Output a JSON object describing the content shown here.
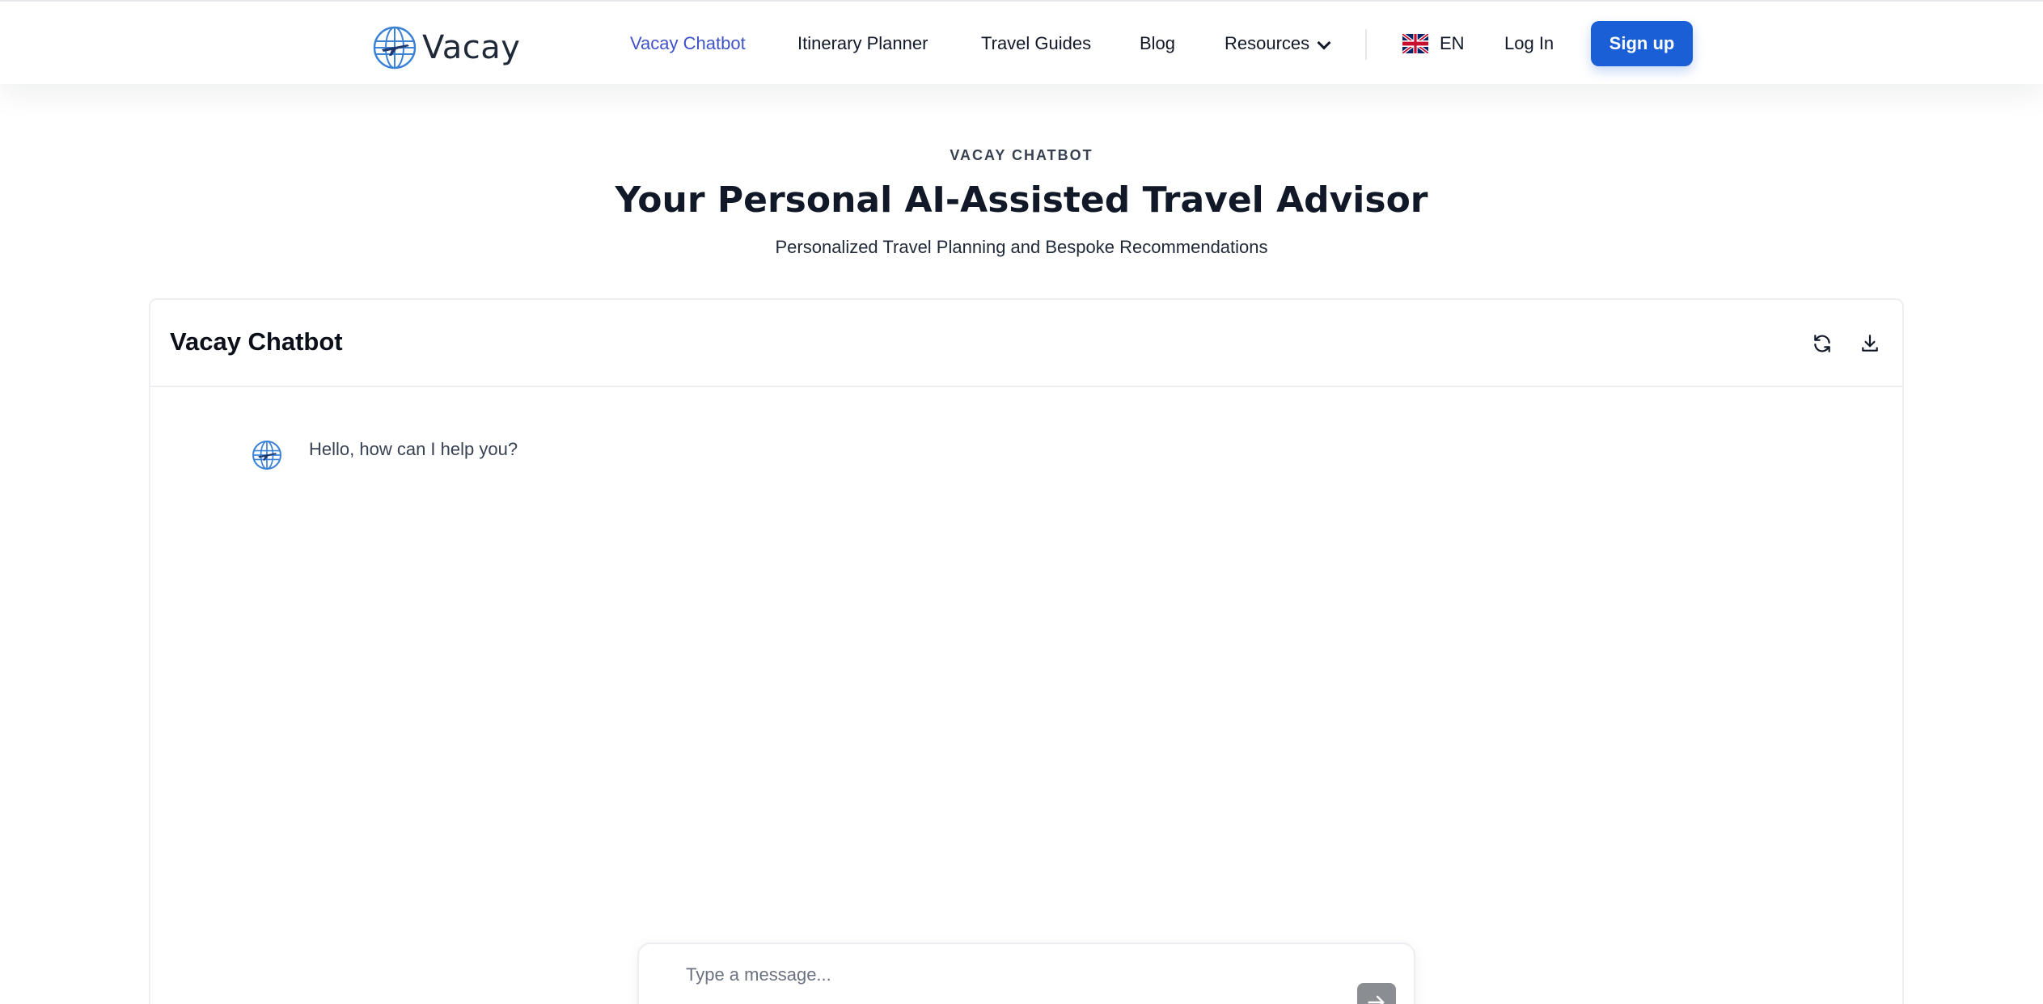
{
  "header": {
    "brand": "Vacay",
    "logo_icon": "globe-airplane-icon",
    "nav": [
      {
        "label": "Vacay Chatbot",
        "active": true
      },
      {
        "label": "Itinerary Planner",
        "active": false
      },
      {
        "label": "Travel Guides",
        "active": false
      },
      {
        "label": "Blog",
        "active": false
      },
      {
        "label": "Resources",
        "active": false,
        "has_dropdown": true
      }
    ],
    "language": {
      "code": "EN",
      "flag_icon": "uk-flag-icon"
    },
    "login_label": "Log In",
    "signup_label": "Sign up"
  },
  "hero": {
    "eyebrow": "VACAY CHATBOT",
    "title": "Your Personal AI-Assisted Travel Advisor",
    "subtitle": "Personalized Travel Planning and Bespoke Recommendations"
  },
  "chat": {
    "title": "Vacay Chatbot",
    "actions": [
      {
        "name": "refresh",
        "icon": "refresh-icon"
      },
      {
        "name": "download",
        "icon": "download-icon"
      }
    ],
    "messages": [
      {
        "sender": "bot",
        "avatar_icon": "globe-airplane-icon",
        "text": "Hello, how can I help you?"
      }
    ],
    "input_placeholder": "Type a message...",
    "input_value": "",
    "send_icon": "arrow-right-icon"
  },
  "colors": {
    "accent": "#1a5fd6",
    "active_nav": "#4052c8",
    "globe": "#3b82d6",
    "send_button": "#8a8d92"
  }
}
